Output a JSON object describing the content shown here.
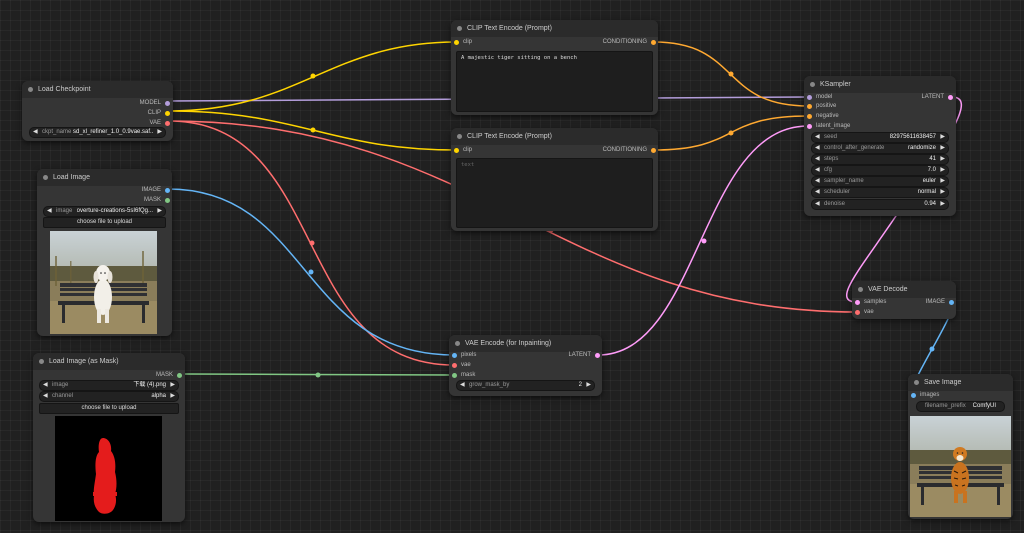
{
  "colors": {
    "model": "#b39ddb",
    "clip": "#ffd500",
    "vae": "#ff6e6e",
    "conditioning": "#ffa931",
    "latent": "#ff9cf9",
    "image": "#64b5f6",
    "mask": "#81c784"
  },
  "load_checkpoint": {
    "title": "Load Checkpoint",
    "outputs": [
      "MODEL",
      "CLIP",
      "VAE"
    ],
    "ckpt_label": "ckpt_name",
    "ckpt_value": "sd_xl_refiner_1.0_0.9vae.saf..."
  },
  "load_image": {
    "title": "Load Image",
    "outputs": [
      "IMAGE",
      "MASK"
    ],
    "image_label": "image",
    "image_value": "overture-creations-5sI6fQg...",
    "upload_label": "choose file to upload"
  },
  "load_image_mask": {
    "title": "Load Image (as Mask)",
    "output": "MASK",
    "image_label": "image",
    "image_value": "下载 (4).png",
    "channel_label": "channel",
    "channel_value": "alpha",
    "upload_label": "choose file to upload"
  },
  "clip_pos": {
    "title": "CLIP Text Encode (Prompt)",
    "input": "clip",
    "output": "CONDITIONING",
    "text": "A majestic tiger sitting on a bench"
  },
  "clip_neg": {
    "title": "CLIP Text Encode (Prompt)",
    "input": "clip",
    "output": "CONDITIONING",
    "placeholder": "text"
  },
  "ksampler": {
    "title": "KSampler",
    "inputs": [
      "model",
      "positive",
      "negative",
      "latent_image"
    ],
    "output": "LATENT",
    "widgets": [
      {
        "label": "seed",
        "value": "82975611638457"
      },
      {
        "label": "control_after_generate",
        "value": "randomize"
      },
      {
        "label": "steps",
        "value": "41"
      },
      {
        "label": "cfg",
        "value": "7.0"
      },
      {
        "label": "sampler_name",
        "value": "euler"
      },
      {
        "label": "scheduler",
        "value": "normal"
      },
      {
        "label": "denoise",
        "value": "0.94"
      }
    ]
  },
  "vae_encode": {
    "title": "VAE Encode (for Inpainting)",
    "inputs": [
      "pixels",
      "vae",
      "mask"
    ],
    "output": "LATENT",
    "grow_label": "grow_mask_by",
    "grow_value": "2"
  },
  "vae_decode": {
    "title": "VAE Decode",
    "inputs": [
      "samples",
      "vae"
    ],
    "output": "IMAGE"
  },
  "save_image": {
    "title": "Save Image",
    "input": "images",
    "prefix_label": "filename_prefix",
    "prefix_value": "ComfyUI"
  },
  "icons": {
    "arrow_left": "◀",
    "arrow_right": "▶"
  }
}
